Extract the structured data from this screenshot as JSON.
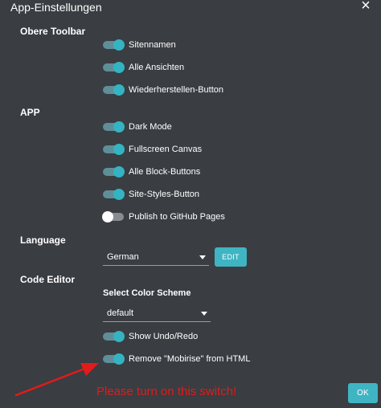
{
  "dialog": {
    "title": "App-Einstellungen",
    "close_label": "×"
  },
  "sections": {
    "toolbar": "Obere Toolbar",
    "app": "APP",
    "language": "Language",
    "code_editor": "Code Editor"
  },
  "toolbar_items": [
    {
      "label": "Sitennamen",
      "on": true
    },
    {
      "label": "Alle Ansichten",
      "on": true
    },
    {
      "label": "Wiederherstellen-Button",
      "on": true
    }
  ],
  "app_items": [
    {
      "label": "Dark Mode",
      "on": true
    },
    {
      "label": "Fullscreen Canvas",
      "on": true
    },
    {
      "label": "Alle Block-Buttons",
      "on": true
    },
    {
      "label": "Site-Styles-Button",
      "on": true
    },
    {
      "label": "Publish to GitHub Pages",
      "on": false
    }
  ],
  "language": {
    "selected": "German",
    "edit_label": "EDIT"
  },
  "code_editor": {
    "color_scheme_label": "Select Color Scheme",
    "color_scheme_selected": "default",
    "items": [
      {
        "label": "Show Undo/Redo",
        "on": true
      },
      {
        "label": "Remove \"Mobirise\" from HTML",
        "on": true
      }
    ]
  },
  "annotation": {
    "text": "Please turn on this switch!",
    "color": "#e21b1b"
  },
  "ok_label": "OK",
  "colors": {
    "background": "#3a3d42",
    "accent": "#3fb4c3",
    "toggle_track_on": "#5f8e98",
    "toggle_knob_on": "#34b3c2"
  }
}
